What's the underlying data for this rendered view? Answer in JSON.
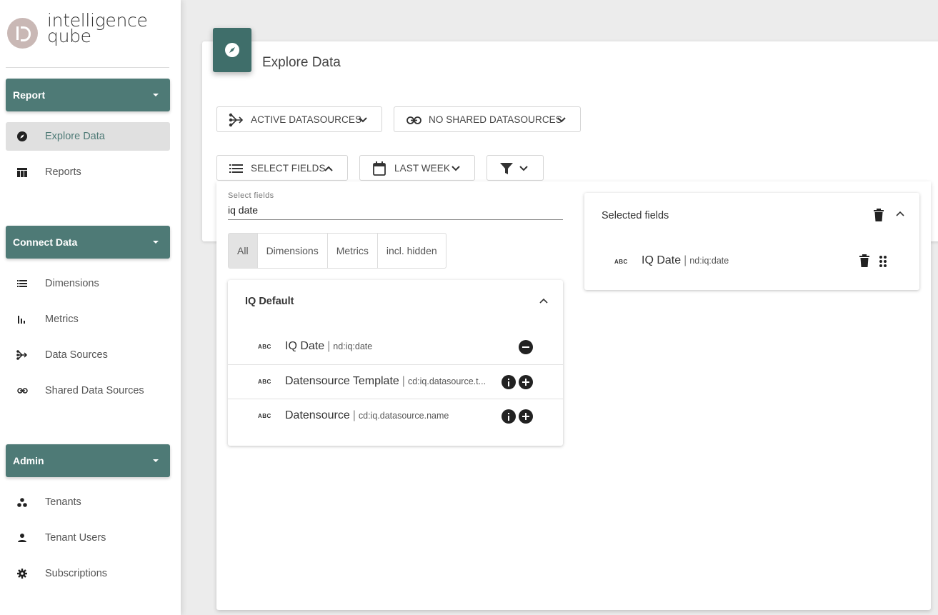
{
  "logo": {
    "line1": "intelligence",
    "line2": "qube"
  },
  "sidebar": {
    "sections": [
      {
        "label": "Report",
        "items": [
          {
            "label": "Explore Data",
            "icon": "compass-icon",
            "active": true
          },
          {
            "label": "Reports",
            "icon": "table-icon"
          }
        ]
      },
      {
        "label": "Connect Data",
        "items": [
          {
            "label": "Dimensions",
            "icon": "list-icon"
          },
          {
            "label": "Metrics",
            "icon": "bar-chart-icon"
          },
          {
            "label": "Data Sources",
            "icon": "merge-arrow-icon"
          },
          {
            "label": "Shared Data Sources",
            "icon": "link-icon"
          }
        ]
      },
      {
        "label": "Admin",
        "items": [
          {
            "label": "Tenants",
            "icon": "group-dots-icon"
          },
          {
            "label": "Tenant Users",
            "icon": "person-icon"
          },
          {
            "label": "Subscriptions",
            "icon": "gear-icon"
          }
        ]
      }
    ]
  },
  "main": {
    "title": "Explore Data",
    "toolbar": {
      "active_datasources": "ACTIVE DATASOURCES",
      "shared_datasources": "NO SHARED DATASOURCES",
      "select_fields": "SELECT FIELDS",
      "date_range": "LAST WEEK"
    }
  },
  "field_picker": {
    "search_label": "Select fields",
    "search_value": "iq date",
    "tabs": [
      "All",
      "Dimensions",
      "Metrics",
      "incl. hidden"
    ],
    "active_tab": "All",
    "group": {
      "title": "IQ Default",
      "rows": [
        {
          "type": "ABC",
          "name": "IQ Date",
          "code": "nd:iq:date",
          "action": "remove"
        },
        {
          "type": "ABC",
          "name": "Datensource Template",
          "code": "cd:iq.datasource.t...",
          "action": "add"
        },
        {
          "type": "ABC",
          "name": "Datensource",
          "code": "cd:iq.datasource.name",
          "action": "add"
        }
      ]
    },
    "selected": {
      "title": "Selected fields",
      "rows": [
        {
          "type": "ABC",
          "name": "IQ Date",
          "code": "nd:iq:date"
        }
      ]
    }
  },
  "colors": {
    "accent": "#4e7a76",
    "accent_dark": "#3f6e6a"
  }
}
